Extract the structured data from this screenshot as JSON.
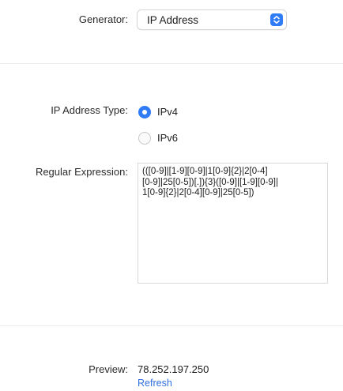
{
  "generator": {
    "label": "Generator:",
    "selected": "IP Address"
  },
  "ip_type": {
    "label": "IP Address Type:",
    "options": [
      {
        "label": "IPv4",
        "selected": true
      },
      {
        "label": "IPv6",
        "selected": false
      }
    ]
  },
  "regex": {
    "label": "Regular Expression:",
    "value": "(([0-9]|[1-9][0-9]|1[0-9]{2}|2[0-4]\n[0-9]|25[0-5])[.]){3}([0-9]|[1-9][0-9]|\n1[0-9]{2}|2[0-4][0-9]|25[0-5])"
  },
  "preview": {
    "label": "Preview:",
    "value": "78.252.197.250",
    "refresh_label": "Refresh"
  },
  "colors": {
    "accent": "#2f7cf6",
    "link": "#2f6fdf",
    "divider": "#ececec"
  }
}
